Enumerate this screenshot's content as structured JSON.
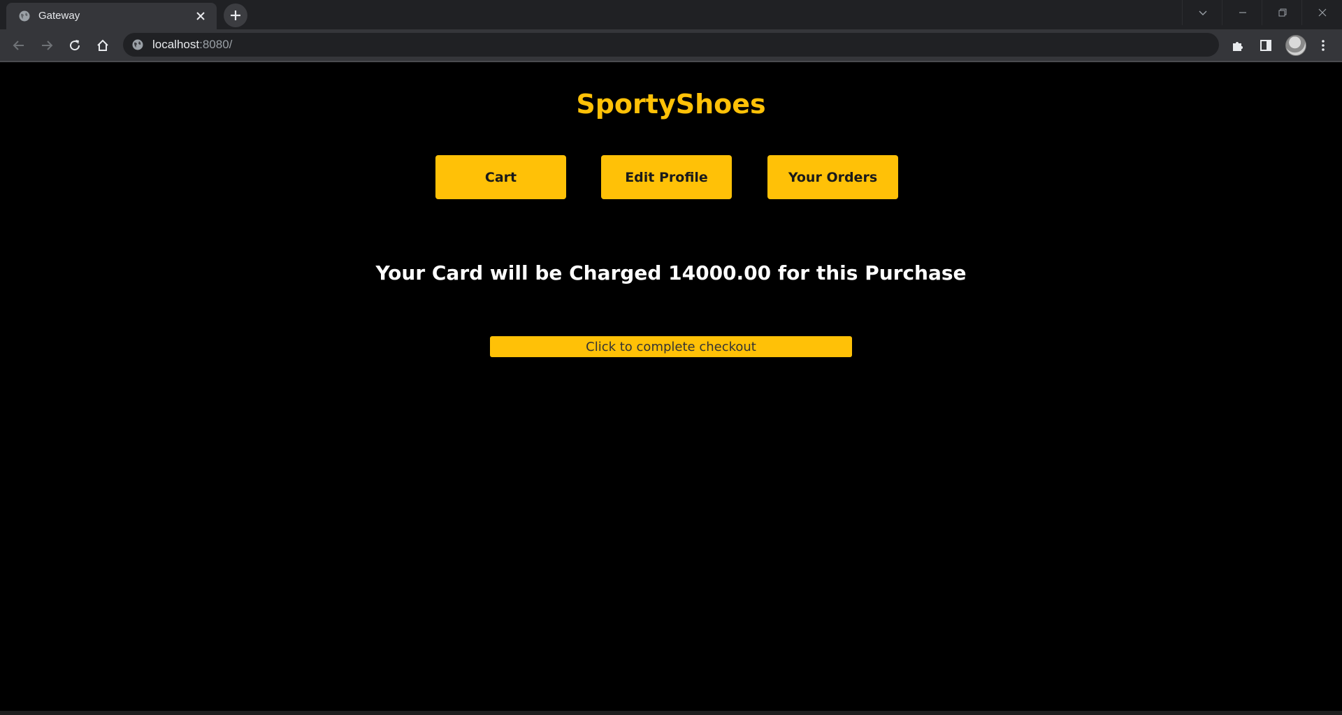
{
  "browser": {
    "tab_title": "Gateway",
    "url_host": "localhost",
    "url_rest": ":8080/"
  },
  "page": {
    "brand": "SportyShoes",
    "nav": {
      "cart": "Cart",
      "edit_profile": "Edit Profile",
      "your_orders": "Your Orders"
    },
    "charge_message": "Your Card will be Charged 14000.00 for this Purchase",
    "checkout_button": "Click to complete checkout"
  },
  "colors": {
    "accent": "#ffc107",
    "background": "#000000",
    "text": "#ffffff"
  }
}
